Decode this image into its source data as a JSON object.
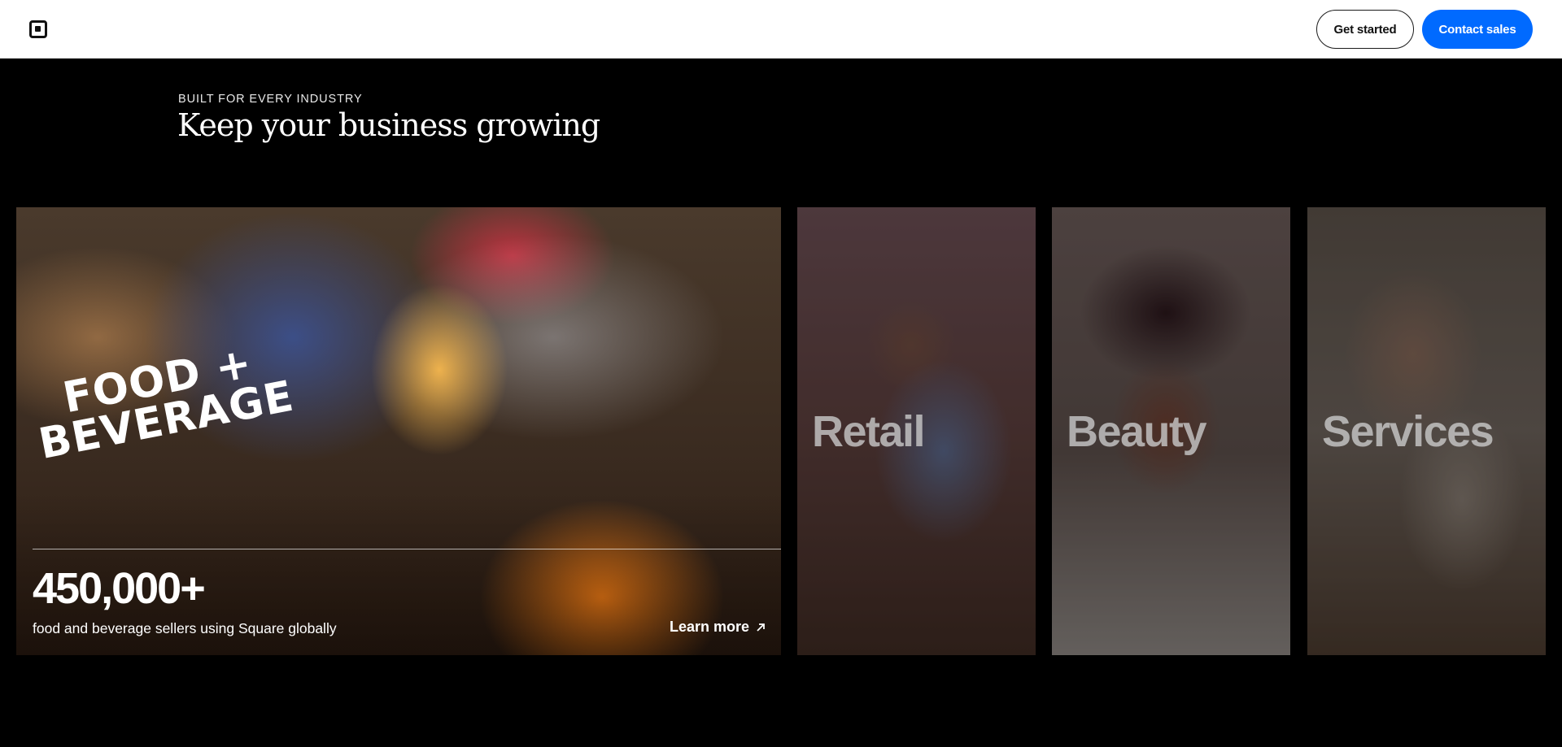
{
  "header": {
    "logo_icon": "square-logo-icon",
    "get_started_label": "Get started",
    "contact_sales_label": "Contact sales",
    "primary_color": "#006aff"
  },
  "section": {
    "eyebrow": "BUILT FOR EVERY INDUSTRY",
    "title": "Keep your business growing"
  },
  "cards": {
    "food": {
      "title_line1": "FOOD +",
      "title_line2": "BEVERAGE",
      "stat": "450,000+",
      "caption": "food and beverage sellers using Square globally",
      "cta": "Learn more",
      "cta_icon": "arrow-up-right-icon"
    },
    "retail": {
      "label": "Retail"
    },
    "beauty": {
      "label": "Beauty"
    },
    "services": {
      "label": "Services"
    }
  }
}
